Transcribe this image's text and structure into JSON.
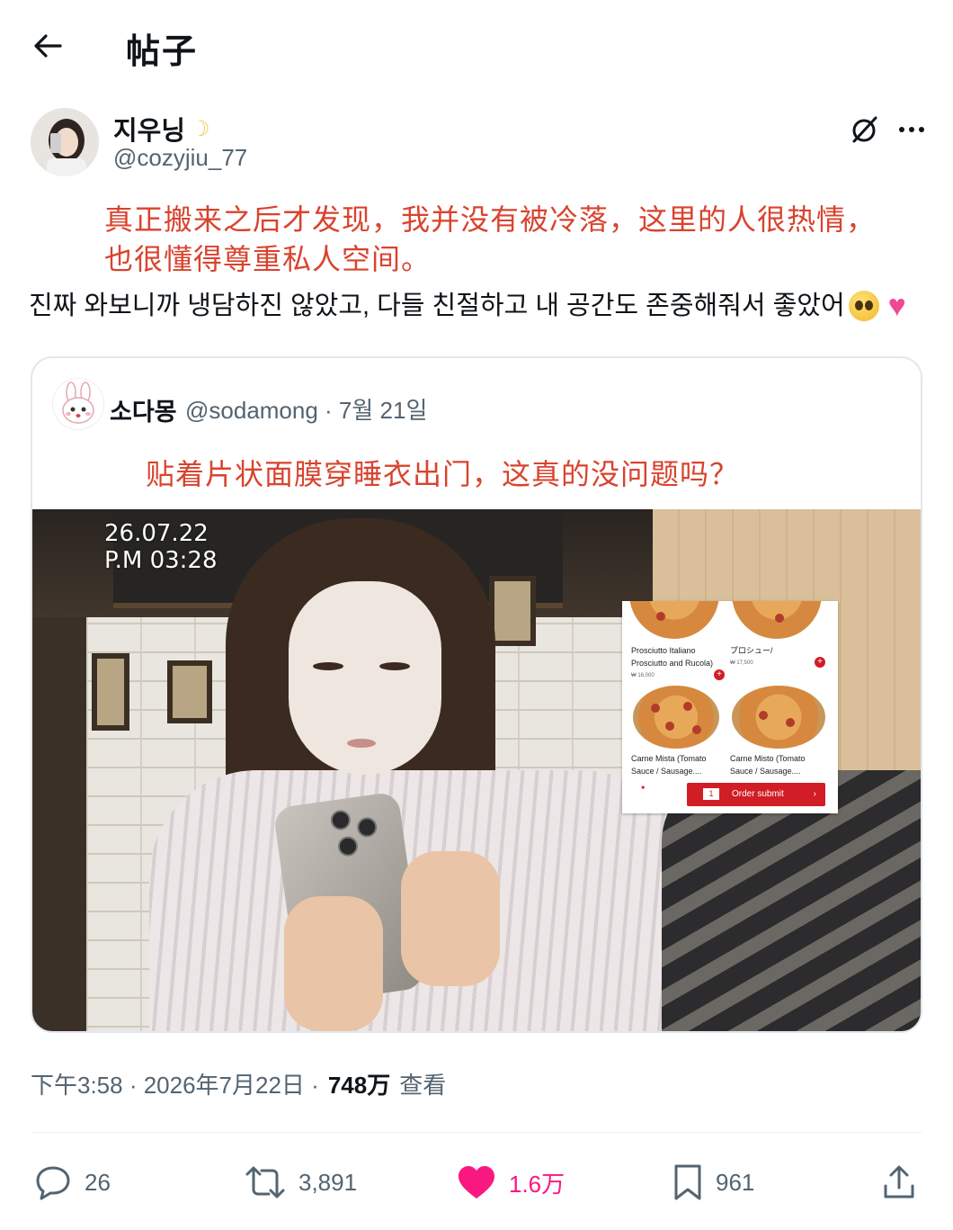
{
  "header": {
    "title": "帖子"
  },
  "post": {
    "display_name": "지우닝",
    "handle": "@cozyjiu_77",
    "caption_translation_line1": "真正搬来之后才发现，我并没有被冷落，这里的人很热情，",
    "caption_translation_line2": "也很懂得尊重私人空间。",
    "text": "진짜 와보니까 냉담하진 않았고, 다들 친절하고 내 공간도 존중해줘서 좋았어"
  },
  "quote": {
    "display_name": "소다몽",
    "meta": "@sodamong · 7월 21일",
    "caption_translation": "贴着片状面膜穿睡衣出门，这真的没问题吗？",
    "photo_stamp_line1": "26.07.22",
    "photo_stamp_line2": "P.M 03:28",
    "menu": {
      "item1_line1": "Prosciutto Italiano",
      "item1_line2": "Prosciutto and Rucola)",
      "item1_price": "₩ 16,000",
      "item2_line1": "プロシュー/",
      "item2_price": "₩ 17,500",
      "item3_line1": "Carne Mista (Tomato",
      "item3_line2": "Sauce / Sausage....",
      "item4_line1": "Carne Misto (Tomato",
      "item4_line2": "Sauce / Sausage....",
      "order_count": "1",
      "order_label": "Order submit"
    }
  },
  "timestamp": {
    "text": "下午3:58 · 2026年7月22日 ·",
    "views": "748万",
    "views_label": "查看"
  },
  "actions": {
    "replies": "26",
    "reposts": "3,891",
    "likes": "1.6万",
    "bookmarks": "961"
  },
  "colors": {
    "caption_red": "#d9432e",
    "like_pink": "#f91880",
    "secondary_text": "#536471"
  }
}
